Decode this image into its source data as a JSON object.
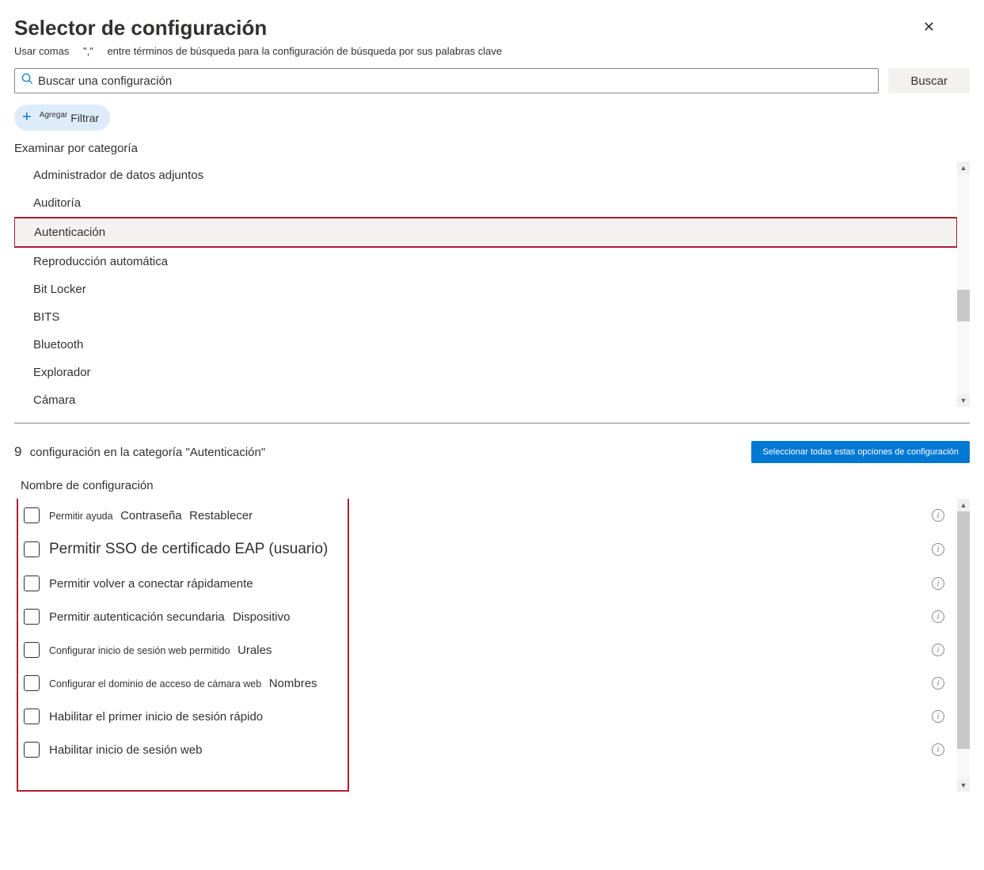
{
  "header": {
    "title": "Selector de configuración",
    "hint_pre": "Usar comas",
    "hint_quote": "\",\"",
    "hint_post": "entre términos de búsqueda para la configuración de búsqueda por sus palabras clave"
  },
  "search": {
    "placeholder": "Buscar una configuración",
    "button": "Buscar"
  },
  "filter": {
    "add": "Agregar",
    "label": "Filtrar"
  },
  "browse_label": "Examinar por categoría",
  "categories": [
    "Administrador de datos adjuntos",
    "Auditoría",
    "Autenticación",
    "Reproducción automática",
    "Bit Locker",
    "BITS",
    "Bluetooth",
    "Explorador",
    "Cámara"
  ],
  "selected_category_index": 2,
  "results": {
    "count": "9",
    "text_pre": "configuración en la categoría",
    "category_quoted": "\"Autenticación\"",
    "select_all": "Seleccionar todas estas opciones de configuración"
  },
  "column_header": "Nombre de configuración",
  "settings": [
    {
      "parts": [
        "Permitir ayuda",
        "Contraseña",
        "Restablecer"
      ],
      "size": "small"
    },
    {
      "parts": [
        "Permitir SSO de certificado EAP (usuario)"
      ],
      "size": "large"
    },
    {
      "parts": [
        "Permitir volver a conectar rápidamente"
      ],
      "size": "normal"
    },
    {
      "parts": [
        "Permitir autenticación secundaria",
        "Dispositivo"
      ],
      "size": "normal"
    },
    {
      "parts": [
        "Configurar inicio de sesión web permitido",
        "Urales"
      ],
      "size": "small"
    },
    {
      "parts": [
        "Configurar el dominio de acceso de cámara web",
        "Nombres"
      ],
      "size": "small"
    },
    {
      "parts": [
        "Habilitar el primer inicio de sesión rápido"
      ],
      "size": "normal"
    },
    {
      "parts": [
        "Habilitar inicio de sesión web"
      ],
      "size": "normal"
    }
  ]
}
